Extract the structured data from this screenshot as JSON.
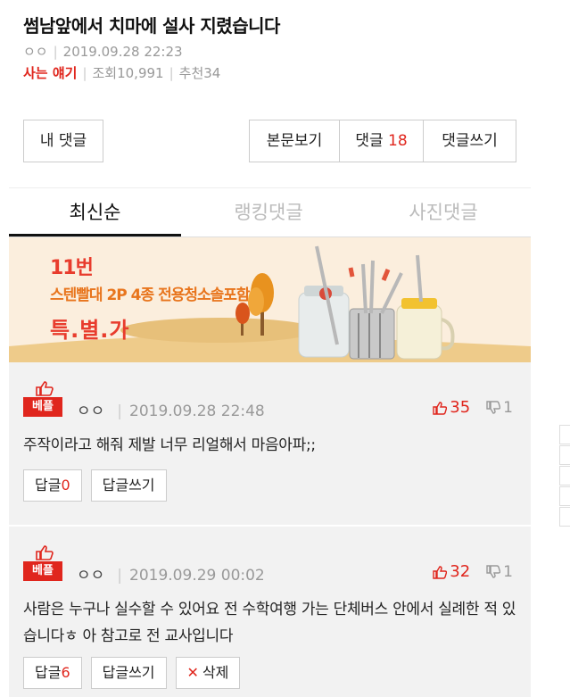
{
  "post": {
    "title": "썸남앞에서 치마에 설사 지렸습니다",
    "author": "ㅇㅇ",
    "datetime": "2019.09.28 22:23",
    "category": "사는 얘기",
    "views": "조회10,991",
    "recommend": "추천34"
  },
  "buttons": {
    "my_comments": "내 댓글",
    "view_body": "본문보기",
    "comments_label": "댓글",
    "comments_count": "18",
    "write_comment": "댓글쓰기"
  },
  "tabs": [
    {
      "label": "최신순",
      "active": true
    },
    {
      "label": "랭킹댓글",
      "active": false
    },
    {
      "label": "사진댓글",
      "active": false
    }
  ],
  "banner": {
    "logo": "11번",
    "line1": "스텐빨대 2P 4종 전용청소솔포함",
    "line2": "특.별.가"
  },
  "comments": [
    {
      "badge": "베플",
      "nick": "ㅇㅇ",
      "datetime": "2019.09.28 22:48",
      "up": "35",
      "down": "1",
      "text": "주작이라고 해줘 제발 너무 리얼해서 마음아파;;",
      "reply_label": "답글",
      "reply_count": "0",
      "write_reply": "답글쓰기"
    },
    {
      "badge": "베플",
      "nick": "ㅇㅇ",
      "datetime": "2019.09.29 00:02",
      "up": "32",
      "down": "1",
      "text": "사람은 누구나 실수할 수 있어요 전 수학여행 가는 단체버스 안에서 실례한 적 있습니다ㅎ 아 참고로 전 교사입니다",
      "reply_label": "답글",
      "reply_count": "6",
      "write_reply": "답글쓰기",
      "delete_label": "삭제"
    }
  ],
  "colors": {
    "accent": "#e0261d",
    "banner_bg": "#fbeedd",
    "comment_bg": "#f2f2f2"
  }
}
